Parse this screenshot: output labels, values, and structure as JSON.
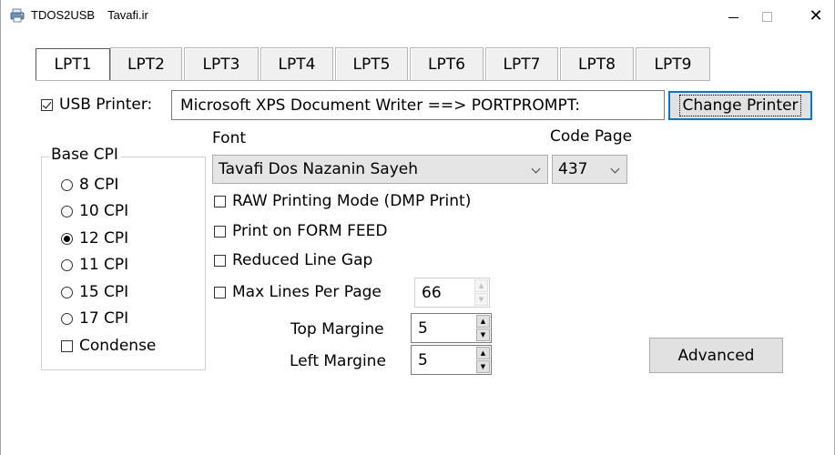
{
  "window": {
    "title_parts": [
      "TDOS2USB",
      "Tavafi.ir"
    ],
    "icon": "printer-app-icon"
  },
  "tabs": [
    "LPT1",
    "LPT2",
    "LPT3",
    "LPT4",
    "LPT5",
    "LPT6",
    "LPT7",
    "LPT8",
    "LPT9"
  ],
  "active_tab": "LPT1",
  "printer": {
    "usb_label": "USB Printer:",
    "usb_checked": true,
    "name": "Microsoft XPS Document Writer ==> PORTPROMPT:",
    "change_label": "Change Printer"
  },
  "base_cpi": {
    "title": "Base CPI",
    "options": [
      "8 CPI",
      "10 CPI",
      "12 CPI",
      "11 CPI",
      "15 CPI",
      "17 CPI"
    ],
    "selected": "12 CPI",
    "condense_label": "Condense",
    "condense_checked": false
  },
  "font": {
    "label": "Font",
    "value": "Tavafi Dos Nazanin Sayeh"
  },
  "code_page": {
    "label": "Code Page",
    "value": "437"
  },
  "options": {
    "raw_mode": "RAW Printing Mode (DMP Print)",
    "form_feed": "Print on FORM FEED",
    "reduced_gap": "Reduced Line Gap",
    "max_lines_label": "Max Lines Per Page",
    "max_lines_value": "66"
  },
  "margins": {
    "top_label": "Top Margine",
    "top_value": "5",
    "left_label": "Left Margine",
    "left_value": "5"
  },
  "advanced_label": "Advanced",
  "colors": {
    "focus_border": "#0078d7",
    "button_face": "#e1e1e1"
  }
}
